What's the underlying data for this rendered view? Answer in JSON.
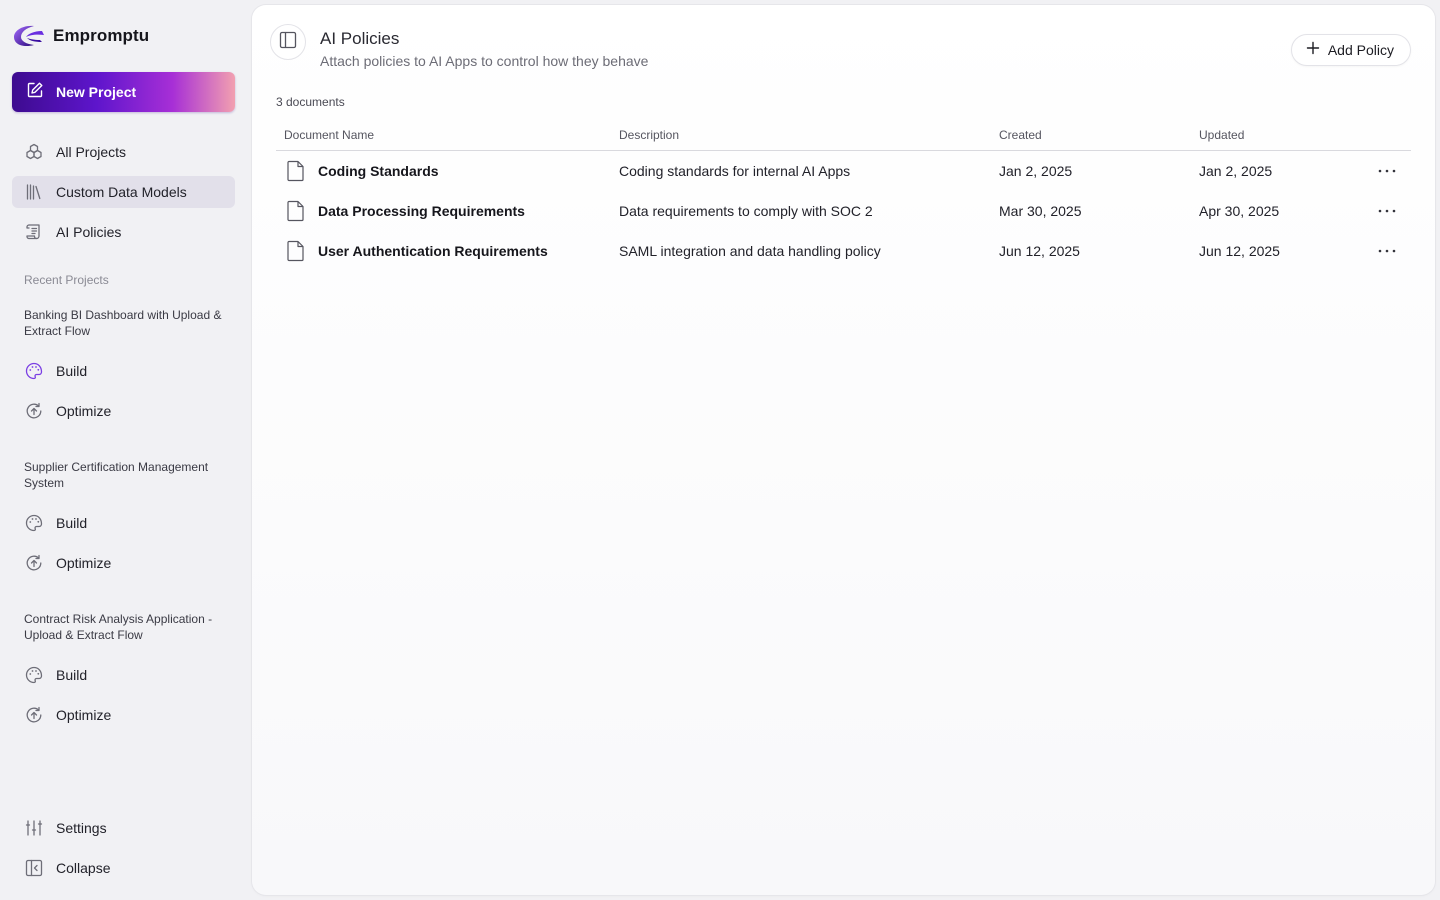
{
  "brand": {
    "name": "Empromptu"
  },
  "sidebar": {
    "new_project": "New Project",
    "nav": [
      {
        "label": "All Projects",
        "icon": "boxes-icon"
      },
      {
        "label": "Custom Data Models",
        "icon": "library-icon",
        "active": true
      },
      {
        "label": "AI Policies",
        "icon": "scroll-icon"
      }
    ],
    "recent_title": "Recent Projects",
    "projects": [
      {
        "title": "Banking BI Dashboard with Upload & Extract Flow",
        "build": "Build",
        "optimize": "Optimize"
      },
      {
        "title": "Supplier Certification Management System",
        "build": "Build",
        "optimize": "Optimize"
      },
      {
        "title": "Contract Risk Analysis Application - Upload & Extract Flow",
        "build": "Build",
        "optimize": "Optimize"
      }
    ],
    "settings": "Settings",
    "collapse": "Collapse"
  },
  "header": {
    "title": "AI Policies",
    "subtitle": "Attach policies to AI Apps to control how they behave",
    "add_button": "Add Policy"
  },
  "table": {
    "count_label": "3 documents",
    "columns": [
      "Document Name",
      "Description",
      "Created",
      "Updated"
    ],
    "rows": [
      {
        "name": "Coding Standards",
        "description": "Coding standards for internal AI Apps",
        "created": "Jan 2, 2025",
        "updated": "Jan 2, 2025"
      },
      {
        "name": "Data Processing Requirements",
        "description": "Data requirements to comply with SOC 2",
        "created": "Mar 30, 2025",
        "updated": "Apr 30, 2025"
      },
      {
        "name": "User Authentication Requirements",
        "description": "SAML integration and data handling policy",
        "created": "Jun 12, 2025",
        "updated": "Jun 12, 2025"
      }
    ]
  },
  "colors": {
    "accent": "#6a1be0",
    "active_bg": "#e2e0ea",
    "build_icon": "#7b3fe4"
  }
}
